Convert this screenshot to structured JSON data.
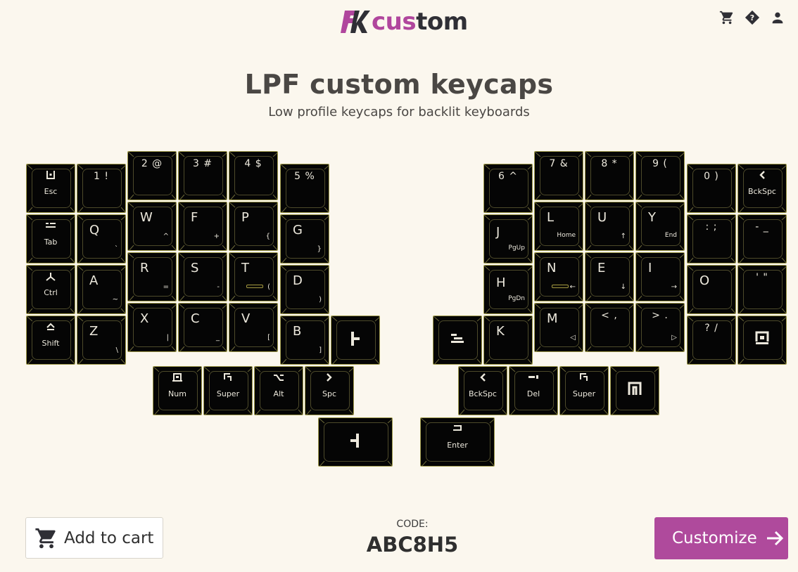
{
  "brand": {
    "name_accent": "cus",
    "name_rest": "tom",
    "accent_color": "#b0469d"
  },
  "header": {
    "icons": [
      "cart-icon",
      "help-icon",
      "account-icon"
    ]
  },
  "hero": {
    "title": "LPF custom keycaps",
    "subtitle": "Low profile keycaps for backlit keyboards"
  },
  "keys": {
    "l_esc": "Esc",
    "l_1": "1 !",
    "l_2": "2 @",
    "l_3": "3 #",
    "l_4": "4 $",
    "l_5": "5 %",
    "l_tab": "Tab",
    "l_q": "Q",
    "l_q_sub": "`",
    "l_w": "W",
    "l_w_sub": "^",
    "l_f": "F",
    "l_f_sub": "+",
    "l_p": "P",
    "l_p_sub": "{",
    "l_g": "G",
    "l_g_sub": "}",
    "l_ctrl": "Ctrl",
    "l_a": "A",
    "l_a_sub": "~",
    "l_r": "R",
    "l_r_sub": "=",
    "l_s": "S",
    "l_s_sub": "-",
    "l_t": "T",
    "l_t_sub": "(",
    "l_d": "D",
    "l_d_sub": ")",
    "l_shift": "Shift",
    "l_z": "Z",
    "l_z_sub": "\\",
    "l_x": "X",
    "l_x_sub": "|",
    "l_c": "C",
    "l_c_sub": "_",
    "l_v": "V",
    "l_v_sub": "[",
    "l_b": "B",
    "l_b_sub": "]",
    "l_num": "Num",
    "l_super": "Super",
    "l_alt": "Alt",
    "l_spc": "Spc",
    "r_6": "6 ^",
    "r_7": "7 &",
    "r_8": "8 *",
    "r_9": "9 (",
    "r_0": "0 )",
    "r_bksp": "BckSpc",
    "r_j": "J",
    "r_j_sub": "PgUp",
    "r_l": "L",
    "r_l_sub": "Home",
    "r_u": "U",
    "r_u_sub": "↑",
    "r_y": "Y",
    "r_y_sub": "End",
    "r_semi": ": ;",
    "r_minus": "- _",
    "r_h": "H",
    "r_h_sub": "PgDn",
    "r_n": "N",
    "r_n_sub": "←",
    "r_e": "E",
    "r_e_sub": "↓",
    "r_i": "I",
    "r_i_sub": "→",
    "r_o": "O",
    "r_quote": "' \"",
    "r_k": "K",
    "r_m": "M",
    "r_m_sub": "◁",
    "r_comma": "< ,",
    "r_dot": "> .",
    "r_dot_sub": "▷",
    "r_slash": "? /",
    "r_bksp2": "BckSpc",
    "r_del": "Del",
    "r_super": "Super",
    "r_enter": "Enter"
  },
  "footer": {
    "add_to_cart": "Add to cart",
    "code_label": "CODE:",
    "code_value": "ABC8H5",
    "customize": "Customize"
  }
}
